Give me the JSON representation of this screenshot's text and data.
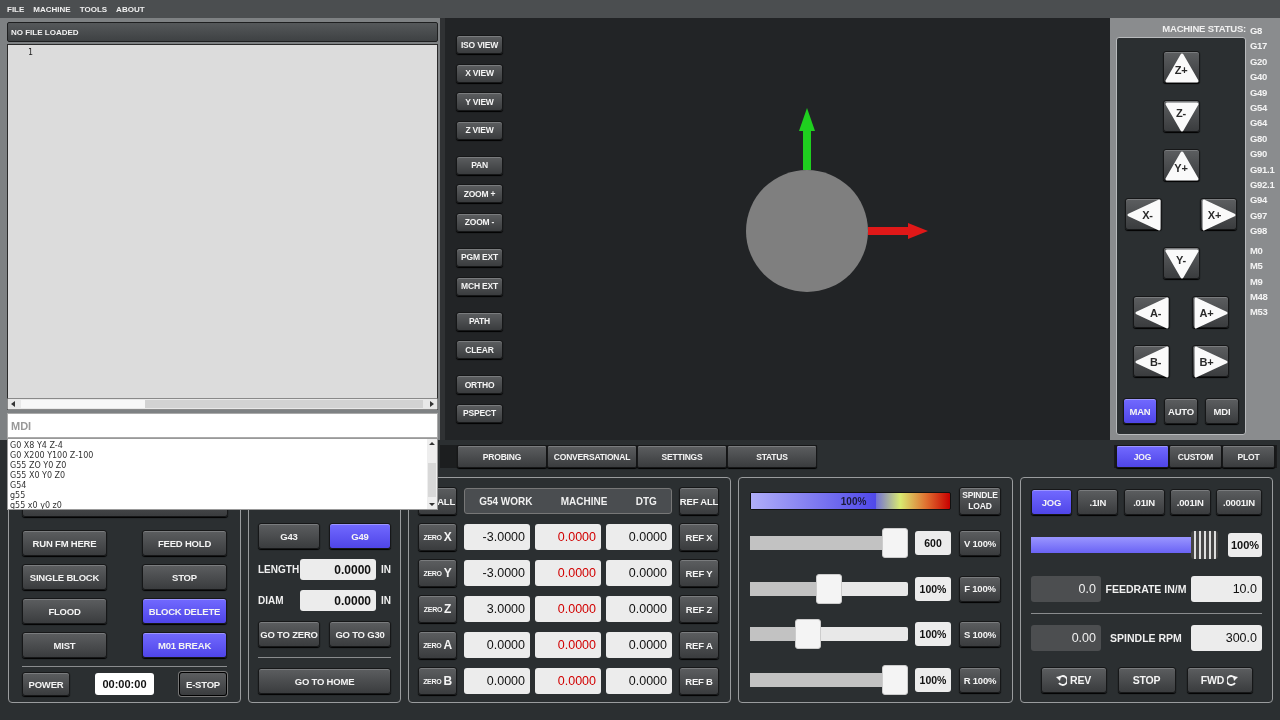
{
  "menu": [
    "FILE",
    "MACHINE",
    "TOOLS",
    "ABOUT"
  ],
  "program": {
    "title": "NO FILE LOADED",
    "line_numbers": [
      "1"
    ]
  },
  "mdi": {
    "placeholder": "MDI",
    "history": [
      "G0 X8 Y4 Z-4",
      "G0 X200 Y100 Z-100",
      "G55 ZO Y0 Z0",
      "G55 X0 Y0 Z0",
      "G54",
      "g55",
      "g55 x0 y0 z0"
    ]
  },
  "view_buttons": [
    [
      "ISO VIEW",
      "X VIEW",
      "Y VIEW",
      "Z VIEW"
    ],
    [
      "PAN",
      "ZOOM +",
      "ZOOM -"
    ],
    [
      "PGM EXT",
      "MCH EXT"
    ],
    [
      "PATH",
      "CLEAR"
    ],
    [
      "ORTHO",
      "PSPECT"
    ]
  ],
  "machine_status": {
    "label": "MACHINE STATUS:",
    "g_codes": [
      "G8",
      "G17",
      "G20",
      "G40",
      "G49",
      "G54",
      "G64",
      "G80",
      "G90",
      "G91.1",
      "G92.1",
      "G94",
      "G97",
      "G98"
    ],
    "m_codes": [
      "M0",
      "M5",
      "M9",
      "M48",
      "M53"
    ]
  },
  "jog_buttons": [
    [
      {
        "label": "Z+",
        "kind": "up"
      }
    ],
    [
      {
        "label": "Z-",
        "kind": "down"
      }
    ],
    [
      {
        "label": "Y+",
        "kind": "up"
      }
    ],
    [
      {
        "label": "X-",
        "kind": "left"
      },
      {
        "label": "X+",
        "kind": "right"
      }
    ],
    [
      {
        "label": "Y-",
        "kind": "down"
      }
    ],
    [
      {
        "label": "A-",
        "kind": "left"
      },
      {
        "label": "A+",
        "kind": "right"
      }
    ],
    [
      {
        "label": "B-",
        "kind": "left"
      },
      {
        "label": "B+",
        "kind": "right"
      }
    ]
  ],
  "modes": [
    {
      "label": "MAN",
      "selected": true
    },
    {
      "label": "AUTO",
      "selected": false
    },
    {
      "label": "MDI",
      "selected": false
    }
  ],
  "tabs_left": [
    {
      "label": "PROBING",
      "selected": false
    },
    {
      "label": "CONVERSATIONAL",
      "selected": false
    },
    {
      "label": "SETTINGS",
      "selected": false
    },
    {
      "label": "STATUS",
      "selected": false
    }
  ],
  "tabs_right": [
    {
      "label": "JOG",
      "selected": true
    },
    {
      "label": "CUSTOM",
      "selected": false
    },
    {
      "label": "PLOT",
      "selected": false
    }
  ],
  "control_buttons": [
    {
      "label": "RUN FM HERE",
      "on": false
    },
    {
      "label": "FEED HOLD",
      "on": false
    },
    {
      "label": "SINGLE BLOCK",
      "on": false
    },
    {
      "label": "STOP",
      "on": false
    },
    {
      "label": "FLOOD",
      "on": false
    },
    {
      "label": "BLOCK DELETE",
      "on": true
    },
    {
      "label": "MIST",
      "on": false
    },
    {
      "label": "M01 BREAK",
      "on": true
    }
  ],
  "power": "POWER",
  "timer": "00:00:00",
  "estop": "E-STOP",
  "tool": {
    "g_buttons": [
      {
        "label": "G43",
        "on": false
      },
      {
        "label": "G49",
        "on": true
      }
    ],
    "fields": [
      {
        "label": "LENGTH",
        "value": "0.0000",
        "unit": "IN"
      },
      {
        "label": "DIAM",
        "value": "0.0000",
        "unit": "IN"
      }
    ],
    "go_buttons": [
      "GO TO ZERO",
      "GO TO G30"
    ],
    "home": "GO TO HOME"
  },
  "dro": {
    "zero_all": "ALL",
    "columns": [
      "G54 WORK",
      "MACHINE",
      "DTG"
    ],
    "ref_all": "REF ALL",
    "rows": [
      {
        "zero": "ZERO",
        "axis": "X",
        "work": "-3.0000",
        "machine": "0.0000",
        "dtg": "0.0000",
        "ref": "REF X"
      },
      {
        "zero": "ZERO",
        "axis": "Y",
        "work": "-3.0000",
        "machine": "0.0000",
        "dtg": "0.0000",
        "ref": "REF Y"
      },
      {
        "zero": "ZERO",
        "axis": "Z",
        "work": "3.0000",
        "machine": "0.0000",
        "dtg": "0.0000",
        "ref": "REF Z"
      },
      {
        "zero": "ZERO",
        "axis": "A",
        "work": "0.0000",
        "machine": "0.0000",
        "dtg": "0.0000",
        "ref": "REF A"
      },
      {
        "zero": "ZERO",
        "axis": "B",
        "work": "0.0000",
        "machine": "0.0000",
        "dtg": "0.0000",
        "ref": "REF B"
      }
    ]
  },
  "overrides": {
    "spindle_load": {
      "level": 0.63,
      "reading": "100%",
      "button": "SPINDLE LOAD"
    },
    "sliders": [
      {
        "level": 1,
        "reading": "600",
        "button": "V 100%"
      },
      {
        "level": 0.5,
        "reading": "100%",
        "button": "F 100%"
      },
      {
        "level": 0.34,
        "reading": "100%",
        "button": "S 100%"
      },
      {
        "level": 1,
        "reading": "100%",
        "button": "R 100%"
      }
    ]
  },
  "jog": {
    "increments": [
      {
        "label": "JOG",
        "selected": true
      },
      {
        "label": ".1IN",
        "selected": false
      },
      {
        "label": ".01IN",
        "selected": false
      },
      {
        "label": ".001IN",
        "selected": false
      },
      {
        "label": ".0001IN",
        "selected": false
      }
    ],
    "rate": {
      "level": 1,
      "reading": "100%"
    },
    "rows": [
      {
        "actual": "0.0",
        "label": "FEEDRATE IN/M",
        "value": "10.0"
      },
      {
        "actual": "0.00",
        "label": "SPINDLE RPM",
        "value": "300.0"
      }
    ],
    "spindle_buttons": [
      {
        "label": "REV",
        "kind": "rev"
      },
      {
        "label": "STOP",
        "kind": "stop"
      },
      {
        "label": "FWD",
        "kind": "fwd"
      }
    ]
  }
}
